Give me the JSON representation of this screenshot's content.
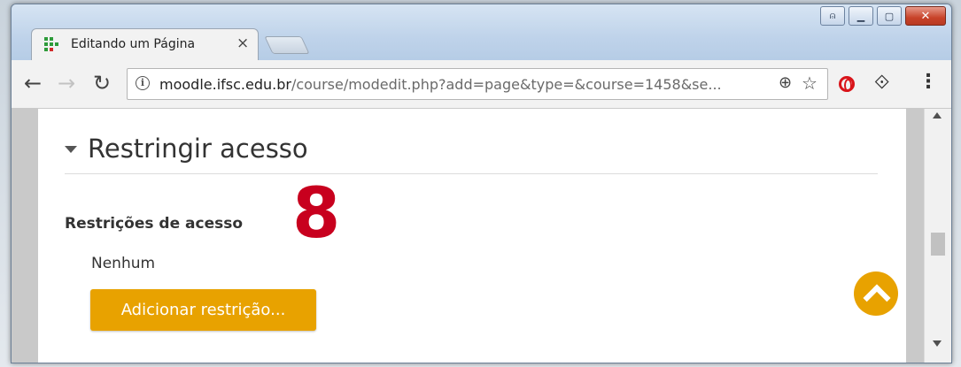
{
  "browser": {
    "tab_title": "Editando um Página",
    "tab_close_glyph": "×",
    "url_host": "moodle.ifsc.edu.br",
    "url_path": "/course/modedit.php?add=page&type=&course=1458&se...",
    "info_glyph": "i",
    "back_glyph": "←",
    "forward_glyph": "→",
    "reload_glyph": "↻",
    "zoom_glyph": "⊕",
    "star_glyph": "☆",
    "extension_glyph": "⟐",
    "menu_glyph": "⋮"
  },
  "window_controls": {
    "user_glyph": "⍝",
    "min_glyph": "▁",
    "max_glyph": "▢",
    "close_glyph": "✕"
  },
  "page": {
    "section_title": "Restringir acesso",
    "restrictions_label": "Restrições de acesso",
    "restrictions_value": "Nenhum",
    "add_button_label": "Adicionar restrição...",
    "annotation_number": "8"
  },
  "colors": {
    "accent": "#e8a200",
    "annotation": "#c8001e"
  }
}
